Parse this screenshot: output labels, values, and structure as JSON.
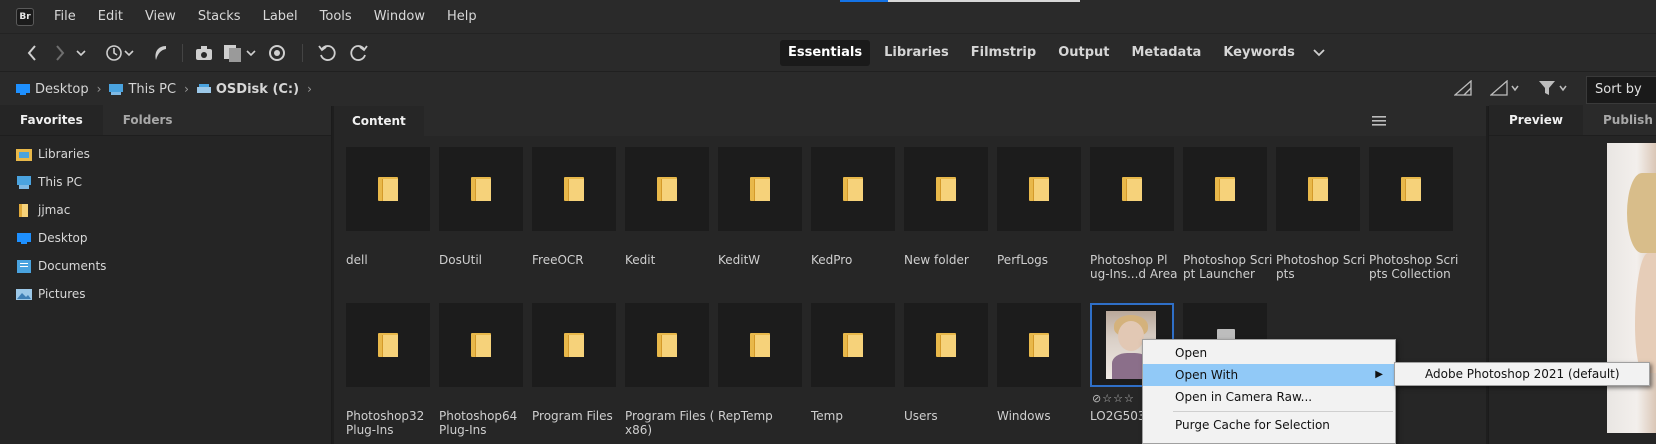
{
  "app": {
    "logo_text": "Br"
  },
  "menubar": {
    "items": [
      "File",
      "Edit",
      "View",
      "Stacks",
      "Label",
      "Tools",
      "Window",
      "Help"
    ]
  },
  "toolbar": {
    "icons": [
      "back-icon",
      "forward-icon",
      "chevron-down-icon",
      "history-icon",
      "boomerang-icon",
      "camera-import-icon",
      "copy-files-icon",
      "refine-icon",
      "rotate-left-icon",
      "rotate-right-icon"
    ],
    "workspaces": [
      "Essentials",
      "Libraries",
      "Filmstrip",
      "Output",
      "Metadata",
      "Keywords"
    ],
    "active_workspace": "Essentials"
  },
  "pathbar": {
    "crumbs": [
      "Desktop",
      "This PC",
      "OSDisk (C:)"
    ],
    "sort_label": "Sort by"
  },
  "left_panel": {
    "tabs": [
      "Favorites",
      "Folders"
    ],
    "favorites": [
      "Libraries",
      "This PC",
      "jjmac",
      "Desktop",
      "Documents",
      "Pictures"
    ]
  },
  "content": {
    "tab": "Content",
    "row1": [
      "dell",
      "DosUtil",
      "FreeOCR",
      "Kedit",
      "KeditW",
      "KedPro",
      "New folder",
      "PerfLogs",
      "Photoshop  Pl\nug-Ins...d Area",
      "Photoshop Scri\npt Launcher",
      "Photoshop Scri\npts",
      "Photoshop Scri\npts Collection"
    ],
    "row2": [
      "Photoshop32\nPlug-Ins",
      "Photoshop64\nPlug-Ins",
      "Program Files",
      "Program Files (\nx86)",
      "RepTemp",
      "Temp",
      "Users",
      "Windows",
      "LO2G503"
    ],
    "rating_glyphs": "⊘☆☆☆"
  },
  "preview_panel": {
    "tabs": [
      "Preview",
      "Publish"
    ]
  },
  "context_menu": {
    "items": [
      "Open",
      "Open With",
      "Open in Camera Raw...",
      "Purge Cache for Selection"
    ],
    "highlighted": "Open With",
    "submenu_item": "Adobe Photoshop 2021 (default)"
  },
  "colors": {
    "accent": "#1473e6",
    "selection": "#2f6fc7",
    "menu_highlight": "#91c9f7",
    "folder": "#f6d27a"
  }
}
